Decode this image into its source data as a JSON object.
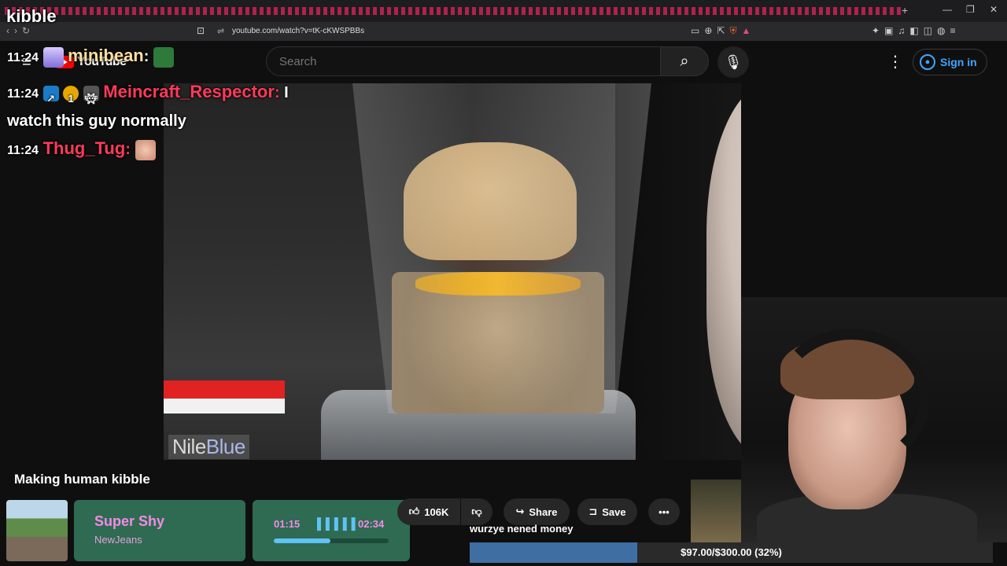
{
  "stream": {
    "title": "kibble"
  },
  "browser": {
    "url": "youtube.com/watch?v=tK-cKWSPBBs",
    "win_min": "—",
    "win_max": "❐",
    "win_close": "✕",
    "tab_plus": "+"
  },
  "youtube": {
    "logo": "YouTube",
    "search_placeholder": "Search",
    "sign_in": "Sign in",
    "video_title": "Making human kibble",
    "watermark_a": "Nile",
    "watermark_b": "Blue",
    "likes": "106K",
    "share": "Share",
    "save": "Save"
  },
  "chat": [
    {
      "time": "11:24",
      "user": "minibean",
      "sep": ":",
      "message": ""
    },
    {
      "time": "11:24",
      "user": "Meincraft_Respector",
      "sep": ":",
      "message": "I watch this guy normally"
    },
    {
      "time": "11:24",
      "user": "Thug_Tug",
      "sep": ":",
      "message": ""
    }
  ],
  "now_playing": {
    "song": "Super Shy",
    "artist": "NewJeans",
    "elapsed": "01:15",
    "total": "02:34",
    "progress_fraction": 0.49
  },
  "goal": {
    "label": "wurzye nened money",
    "text": "$97.00/$300.00 (32%)",
    "fraction": 0.32
  },
  "colors": {
    "accent_red": "#ff3a5a",
    "song_pink": "#f28be5",
    "widget_green": "#2f6b52",
    "goal_blue": "#3f6ea3"
  }
}
